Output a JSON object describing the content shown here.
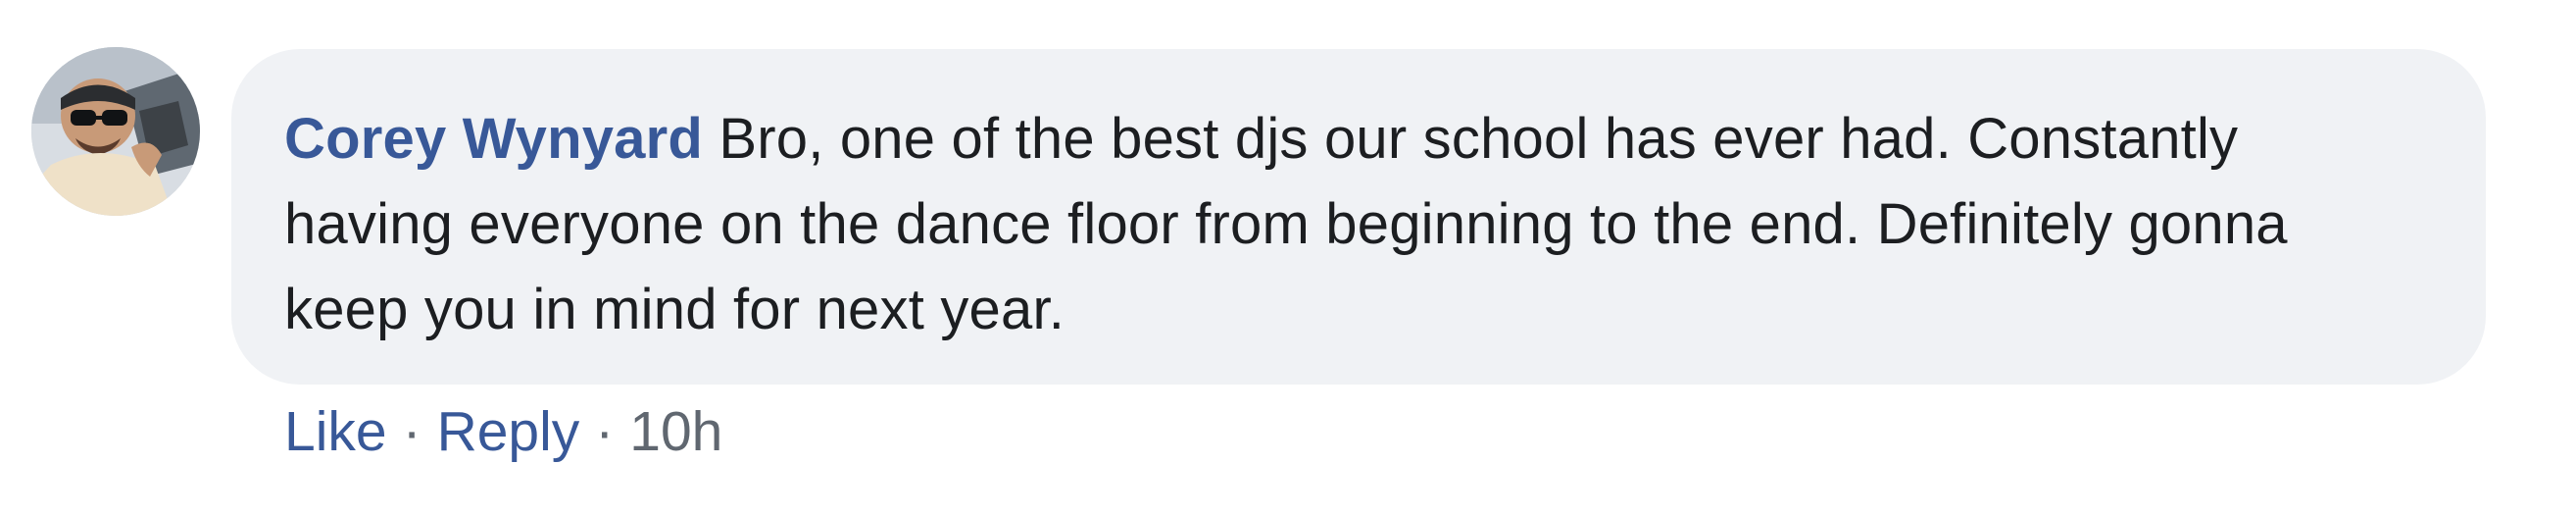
{
  "comment": {
    "author": "Corey Wynyard",
    "text": "Bro, one of the best djs our school has ever had. Constantly having everyone on the dance floor from beginning to the end. Definitely gonna keep you in mind for next year.",
    "actions": {
      "like_label": "Like",
      "separator": "·",
      "reply_label": "Reply",
      "timestamp": "10h"
    }
  },
  "colors": {
    "author_link": "#385898",
    "bubble_background": "#f0f2f5",
    "body_text": "#1c1e21",
    "meta_text": "#606770"
  },
  "icons": {
    "avatar": "profile-photo-avatar"
  }
}
